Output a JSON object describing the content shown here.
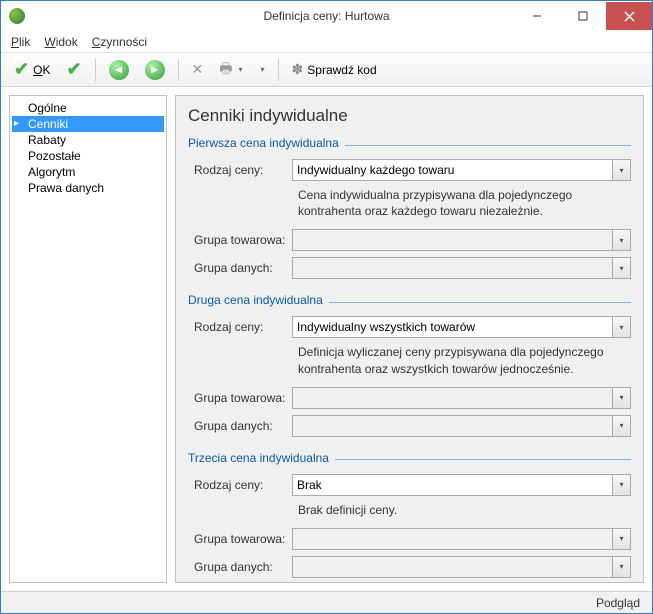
{
  "window": {
    "title": "Definicja ceny: Hurtowa"
  },
  "menu": {
    "file": "Plik",
    "view": "Widok",
    "actions": "Czynności"
  },
  "toolbar": {
    "ok": "OK",
    "check_code": "Sprawdź kod"
  },
  "sidebar": {
    "items": [
      {
        "label": "Ogólne"
      },
      {
        "label": "Cenniki"
      },
      {
        "label": "Rabaty"
      },
      {
        "label": "Pozostałe"
      },
      {
        "label": "Algorytm"
      },
      {
        "label": "Prawa danych"
      }
    ],
    "selected_index": 1
  },
  "main": {
    "heading": "Cenniki indywidualne",
    "sections": [
      {
        "legend": "Pierwsza cena indywidualna",
        "price_type_label": "Rodzaj ceny:",
        "price_type_value": "Indywidualny każdego towaru",
        "description": "Cena indywidualna przypisywana dla pojedynczego kontrahenta oraz każdego towaru niezależnie.",
        "goods_group_label": "Grupa towarowa:",
        "goods_group_value": "",
        "data_group_label": "Grupa danych:",
        "data_group_value": ""
      },
      {
        "legend": "Druga cena indywidualna",
        "price_type_label": "Rodzaj ceny:",
        "price_type_value": "Indywidualny wszystkich towarów",
        "description": "Definicja wyliczanej ceny przypisywana dla pojedynczego kontrahenta oraz wszystkich towarów jednocześnie.",
        "goods_group_label": "Grupa towarowa:",
        "goods_group_value": "",
        "data_group_label": "Grupa danych:",
        "data_group_value": ""
      },
      {
        "legend": "Trzecia cena indywidualna",
        "price_type_label": "Rodzaj ceny:",
        "price_type_value": "Brak",
        "description": "Brak definicji ceny.",
        "goods_group_label": "Grupa towarowa:",
        "goods_group_value": "",
        "data_group_label": "Grupa danych:",
        "data_group_value": ""
      }
    ]
  },
  "statusbar": {
    "mode": "Podgląd"
  }
}
